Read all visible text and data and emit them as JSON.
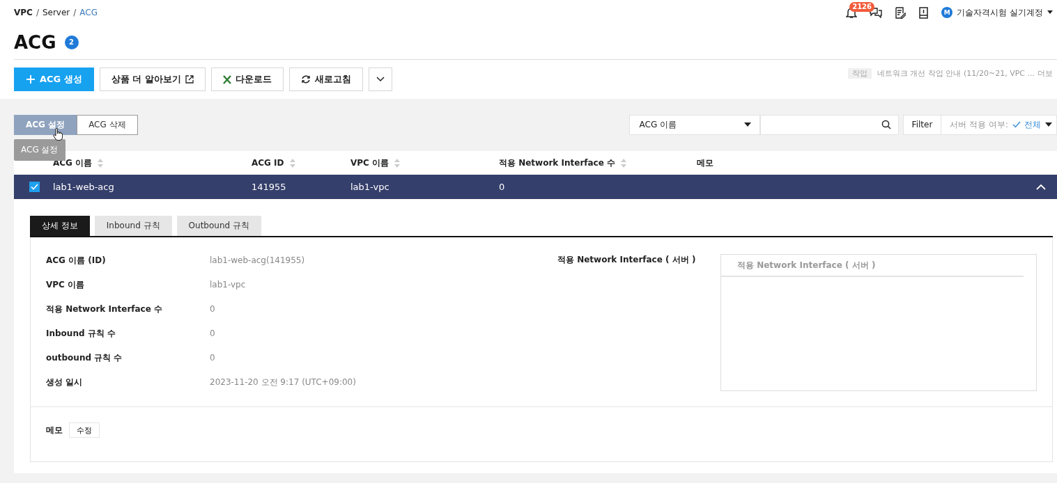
{
  "breadcrumb_separator": "/",
  "breadcrumb": [
    {
      "label": "VPC",
      "current": false
    },
    {
      "label": "Server",
      "current": false
    },
    {
      "label": "ACG",
      "current": true
    }
  ],
  "header": {
    "notification_count": "2126",
    "user": {
      "initial": "M",
      "name": "기술자격시험 실기계정"
    }
  },
  "title": "ACG",
  "count": "2",
  "toolbar": [
    {
      "kind": "primary",
      "label": "ACG 생성"
    },
    {
      "kind": "external",
      "label": "상품 더 알아보기"
    },
    {
      "kind": "excel",
      "label": "다운로드"
    },
    {
      "kind": "refresh",
      "label": "새로고침"
    },
    {
      "kind": "more"
    }
  ],
  "notices": [
    {
      "tag": "작업",
      "text": "네트워크 개선 작업 안내 (11/20~21, VPC ... 더보"
    }
  ],
  "actions": [
    {
      "label": "ACG 설정",
      "hovered": true
    },
    {
      "label": "ACG 삭제",
      "hovered": false
    }
  ],
  "tooltip": "ACG 설정",
  "search": {
    "field": "ACG 이름"
  },
  "filter": {
    "label": "Filter",
    "server_label": "서버 적용 여부:",
    "value": "전체"
  },
  "table": {
    "columns": [
      "ACG 이름",
      "ACG ID",
      "VPC 이름",
      "적용 Network Interface 수",
      "메모"
    ],
    "rows": [
      {
        "checked": true,
        "expanded": true,
        "cells": [
          "lab1-web-acg",
          "141955",
          "lab1-vpc",
          "0",
          ""
        ]
      }
    ]
  },
  "detail": {
    "tabs": [
      {
        "label": "상세 정보",
        "selected": true
      },
      {
        "label": "Inbound 규칙",
        "selected": false
      },
      {
        "label": "Outbound 규칙",
        "selected": false
      }
    ],
    "fields": [
      {
        "label": "ACG 이름 (ID)",
        "value": "lab1-web-acg(141955)"
      },
      {
        "label": "VPC 이름",
        "value": "lab1-vpc"
      },
      {
        "label": "적용 Network Interface 수",
        "value": "0"
      },
      {
        "label": "Inbound 규칙 수",
        "value": "0"
      },
      {
        "label": "outbound 규칙 수",
        "value": "0"
      },
      {
        "label": "생성 일시",
        "value": "2023-11-20 오전 9:17 (UTC+09:00)"
      }
    ],
    "interface_label": "적용 Network Interface ( 서버 )",
    "interface_list_title": "적용 Network Interface ( 서버 )",
    "memo_label": "메모",
    "memo_edit": "수정"
  }
}
